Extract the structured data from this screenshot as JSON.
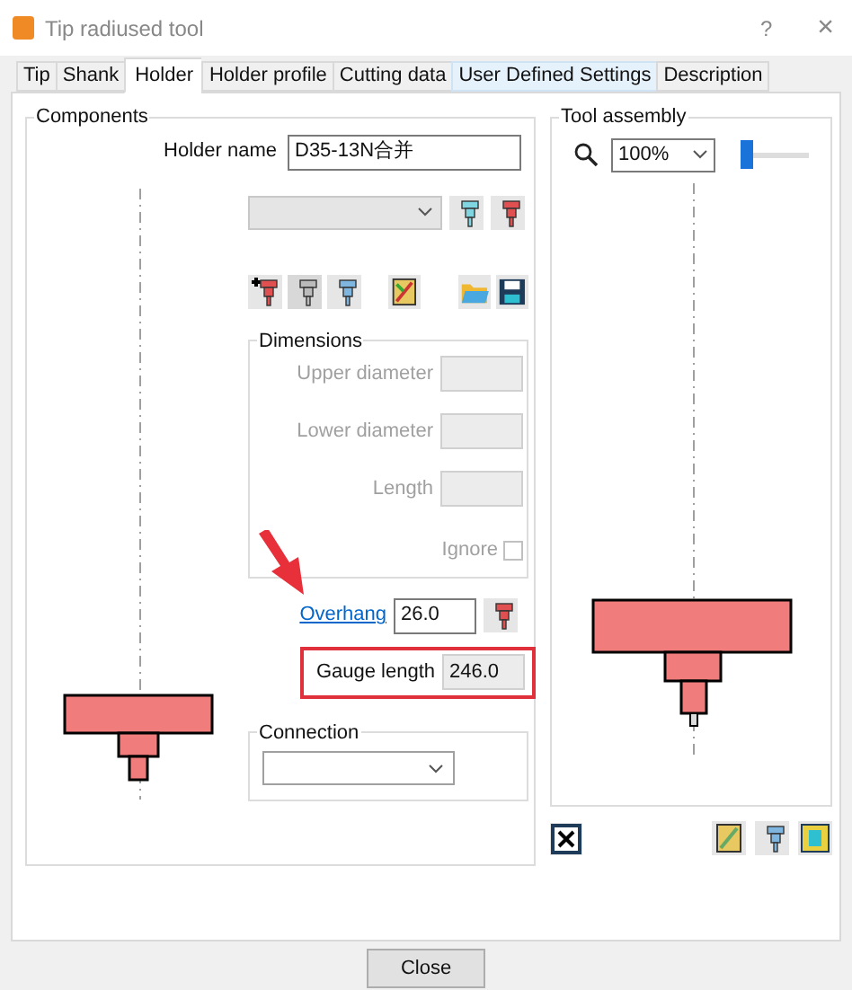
{
  "window": {
    "title": "Tip radiused tool",
    "help": "?",
    "close": "×"
  },
  "tabs": [
    {
      "label": "Tip",
      "selected": false,
      "hovered": false
    },
    {
      "label": "Shank",
      "selected": false,
      "hovered": false
    },
    {
      "label": "Holder",
      "selected": true,
      "hovered": false
    },
    {
      "label": "Holder profile",
      "selected": false,
      "hovered": false
    },
    {
      "label": "Cutting data",
      "selected": false,
      "hovered": false
    },
    {
      "label": "User Defined Settings",
      "selected": false,
      "hovered": true
    },
    {
      "label": "Description",
      "selected": false,
      "hovered": false
    }
  ],
  "components": {
    "title": "Components",
    "holder_name": {
      "label": "Holder name",
      "value": "D35-13N合并"
    },
    "dimensions": {
      "title": "Dimensions",
      "disabled": true,
      "fields": [
        {
          "label": "Upper diameter"
        },
        {
          "label": "Lower diameter"
        },
        {
          "label": "Length"
        }
      ],
      "ignore": {
        "label": "Ignore",
        "checked": false
      }
    },
    "overhang": {
      "label": "Overhang",
      "value": "26.0"
    },
    "gauge_length": {
      "label": "Gauge length",
      "value": "246.0",
      "highlighted": true
    },
    "connection": {
      "title": "Connection"
    }
  },
  "tool_assembly": {
    "title": "Tool assembly",
    "zoom": "100%",
    "slider": {
      "level": 0
    }
  },
  "buttons": [
    "Close"
  ]
}
